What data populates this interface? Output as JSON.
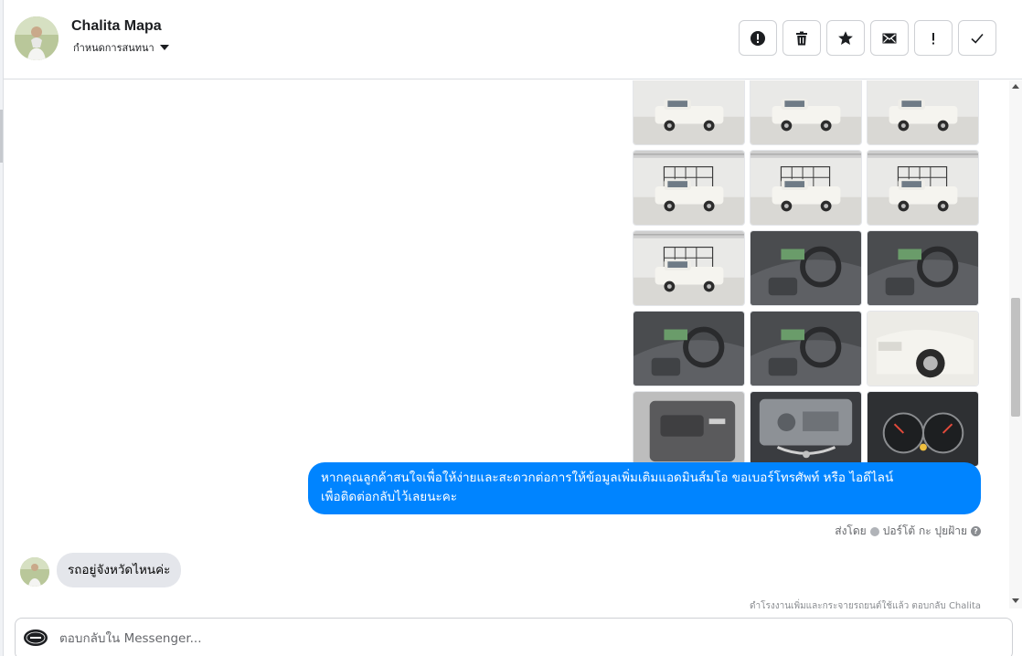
{
  "header": {
    "contact_name": "Chalita Mapa",
    "assign_label": "กำหนดการสนทนา",
    "actions": [
      {
        "name": "spam-button",
        "icon": "alert-circle-icon"
      },
      {
        "name": "delete-button",
        "icon": "trash-icon"
      },
      {
        "name": "star-button",
        "icon": "star-icon"
      },
      {
        "name": "mark-unread-button",
        "icon": "envelope-icon"
      },
      {
        "name": "follow-up-button",
        "icon": "exclamation-icon"
      },
      {
        "name": "mark-done-button",
        "icon": "checkmark-icon"
      }
    ]
  },
  "thread": {
    "photo_grid": [
      {
        "subject": "white pickup front view"
      },
      {
        "subject": "white pickup front view"
      },
      {
        "subject": "white pickup angled front"
      },
      {
        "subject": "pickup rear with cargo rack"
      },
      {
        "subject": "pickup rear with cargo rack"
      },
      {
        "subject": "pickup side with cargo rack"
      },
      {
        "subject": "pickup side with cargo rack"
      },
      {
        "subject": "interior steering wheel"
      },
      {
        "subject": "interior dashboard"
      },
      {
        "subject": "dashboard console"
      },
      {
        "subject": "driver seat"
      },
      {
        "subject": "headlight close-up"
      },
      {
        "subject": "door panel"
      },
      {
        "subject": "engine bay"
      },
      {
        "subject": "instrument cluster"
      }
    ],
    "outgoing_message": {
      "line1": "หากคุณลูกค้าสนใจเพื่อให้ง่ายและสะดวกต่อการให้ข้อมูลเพิ่มเติมแอดมินส์มโอ ขอเบอร์โทรศัพท์ หรือ ไอดีไลน์",
      "line2": "เพื่อติดต่อกลับไว้เลยนะคะ"
    },
    "sent_by_label": "ส่งโดย",
    "sent_by_name": "ปอร์โต้ กะ ปุยฝ้าย",
    "incoming_message": "รถอยู่จังหวัดไหนค่ะ",
    "cut_note": "ดำโรงงานเพิ่มและกระจายรถยนต์ใช้แล้ว ตอบกลับ Chalita"
  },
  "composer": {
    "placeholder": "ตอบกลับใน Messenger..."
  },
  "colors": {
    "outgoing_bubble": "#0084ff",
    "incoming_bubble": "#e4e6eb",
    "border": "#ced0d4"
  }
}
